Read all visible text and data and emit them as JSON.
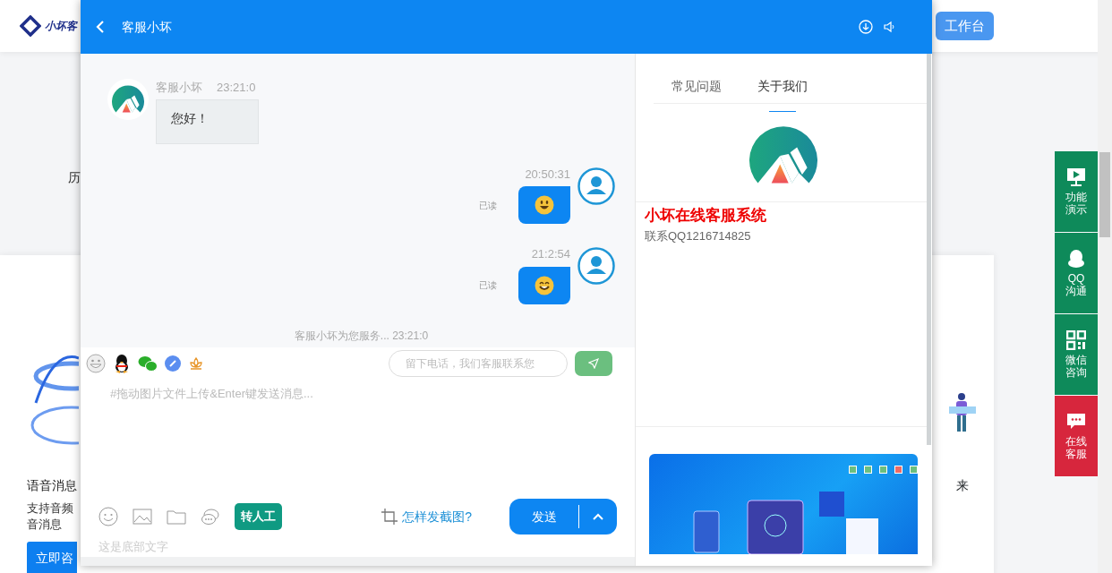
{
  "background_page": {
    "logo_text": "小坏客",
    "header_button": "工作台",
    "left_fragment": "历",
    "feature": {
      "title": "语音消息",
      "lines": [
        "支持音频",
        "音消息"
      ],
      "button": "立即咨"
    },
    "right_fragment": "来"
  },
  "chat_window": {
    "title": "客服小坏",
    "messages": [
      {
        "kind": "agent",
        "sender": "客服小坏",
        "time": "23:21:0",
        "text": "您好！"
      },
      {
        "kind": "visitor",
        "time": "20:50:31",
        "emoji": {
          "kind": "grinning"
        },
        "read_label": "已读"
      },
      {
        "kind": "visitor",
        "time": "21:2:54",
        "emoji": {
          "kind": "beaming"
        },
        "read_label": "已读"
      }
    ],
    "notice": "客服小坏为您服务... 23:21:0",
    "phone_field": {
      "placeholder": "留下电话，我们客服联系您"
    },
    "message_input": {
      "placeholder": "#拖动图片文件上传&Enter键发送消息..."
    },
    "transfer_button": "转人工",
    "screenshot_help": "怎样发截图?",
    "send_button": "发送",
    "footer_text": "这是底部文字"
  },
  "side_panel": {
    "tabs": [
      {
        "label": "常见问题",
        "selected": false
      },
      {
        "label": "关于我们",
        "selected": true
      }
    ],
    "company_name": "小坏在线客服系统",
    "contact": "联系QQ1216714825",
    "carousel_dots": [
      {
        "selected": false
      },
      {
        "selected": false
      },
      {
        "selected": false
      },
      {
        "selected": true
      },
      {
        "selected": false
      }
    ]
  },
  "float_bar": [
    {
      "kind": "demo",
      "lines": [
        "功能",
        "演示"
      ],
      "color": "#0e8a5a"
    },
    {
      "kind": "qq",
      "lines": [
        "QQ",
        "沟通"
      ],
      "color": "#0e8a5a"
    },
    {
      "kind": "wechat",
      "lines": [
        "微信",
        "咨询"
      ],
      "color": "#0e8a5a"
    },
    {
      "kind": "chat",
      "lines": [
        "在线",
        "客服"
      ],
      "color": "#d7263d"
    }
  ]
}
